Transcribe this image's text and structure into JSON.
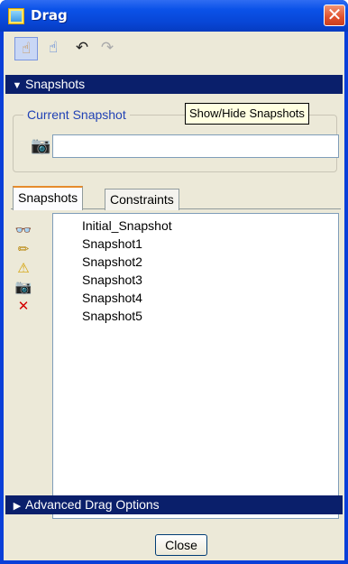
{
  "window": {
    "title": "Drag",
    "close_glyph": "✕"
  },
  "toolbar": {
    "buttons": [
      {
        "icon": "hand-drag-icon",
        "glyph": "☝",
        "active": true
      },
      {
        "icon": "hand-snapshot-icon",
        "glyph": "☝",
        "active": false
      },
      {
        "icon": "undo-icon",
        "glyph": "↶",
        "active": false
      },
      {
        "icon": "redo-icon",
        "glyph": "↷",
        "active": false
      }
    ]
  },
  "snapshots_section": {
    "label": "Snapshots",
    "arrow": "▼"
  },
  "current_snapshot": {
    "legend": "Current Snapshot",
    "value": "",
    "camera_glyph": "📷"
  },
  "tooltip": {
    "text": "Show/Hide Snapshots"
  },
  "tabs": [
    {
      "label": "Snapshots",
      "selected": true
    },
    {
      "label": "Constraints",
      "selected": false
    }
  ],
  "side_tools": [
    {
      "icon": "glasses-icon",
      "glyph": "👓"
    },
    {
      "icon": "pencil-icon",
      "glyph": "✏"
    },
    {
      "icon": "add-warning-icon",
      "glyph": "⚠"
    },
    {
      "icon": "camera-save-icon",
      "glyph": "📷"
    },
    {
      "icon": "delete-icon",
      "glyph": "✕"
    }
  ],
  "snapshot_list": [
    "Initial_Snapshot",
    "Snapshot1",
    "Snapshot2",
    "Snapshot3",
    "Snapshot4",
    "Snapshot5"
  ],
  "advanced_section": {
    "label": "Advanced Drag Options",
    "arrow": "▶"
  },
  "footer": {
    "close_label": "Close"
  },
  "colors": {
    "title_bar": "#0b52e8",
    "section_bar": "#0a1f6b",
    "client_bg": "#ece9d8",
    "legend": "#2142b5",
    "tab_highlight": "#e68b2c"
  }
}
